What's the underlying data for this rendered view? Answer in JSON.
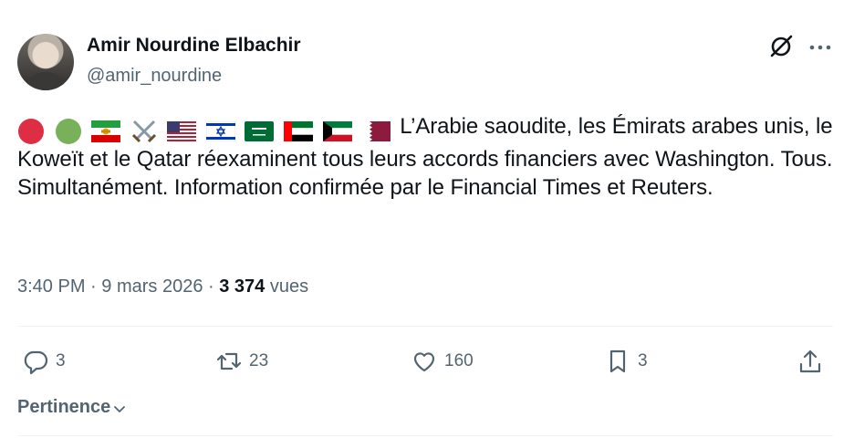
{
  "author": {
    "display_name": "Amir Nourdine Elbachir",
    "handle": "@amir_nourdine"
  },
  "tweet": {
    "emojis": [
      "red-circle",
      "green-circle",
      "iran-lion-sun-flag",
      "crossed-swords",
      "us-flag",
      "israel-flag",
      "saudi-arabia-flag",
      "uae-flag",
      "kuwait-flag",
      "qatar-flag"
    ],
    "text": "L’Arabie saoudite, les Émirats arabes unis, le Koweït et le Qatar réexaminent tous leurs accords financiers avec Washington. Tous. Simultanément. Information confirmée par le Financial Times et Reuters."
  },
  "meta": {
    "time": "3:40 PM",
    "sep1": " · ",
    "date": "9 mars 2026",
    "sep2": " · ",
    "views_count": "3 374",
    "views_label": " vues"
  },
  "actions": {
    "replies": "3",
    "reposts": "23",
    "likes": "160",
    "bookmarks": "3"
  },
  "sort": {
    "label": "Pertinence"
  },
  "colors": {
    "text": "#0f1419",
    "secondary": "#536471",
    "divider": "#eff3f4"
  }
}
